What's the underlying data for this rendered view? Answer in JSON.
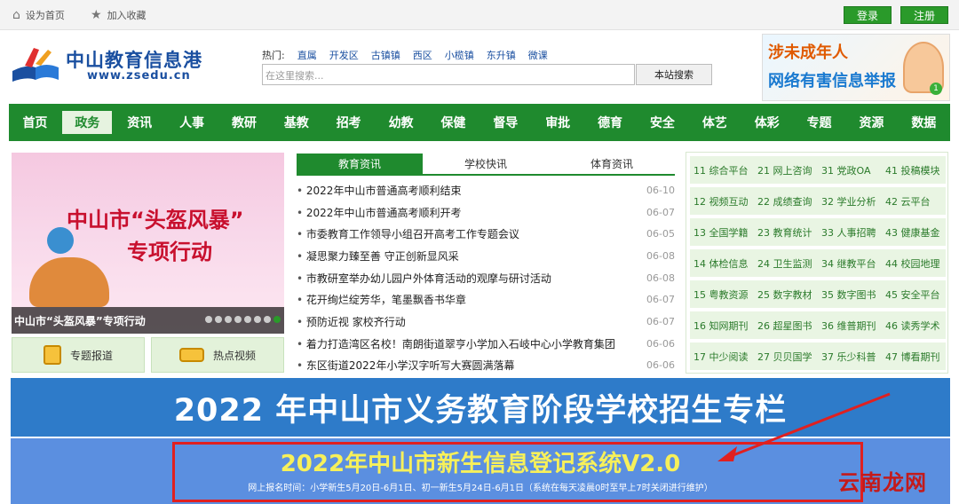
{
  "topbar": {
    "set_home": "设为首页",
    "bookmark": "加入收藏",
    "login": "登录",
    "register": "注册"
  },
  "logo": {
    "name": "中山教育信息港",
    "url": "www.zsedu.cn"
  },
  "hot": {
    "label": "热门:",
    "items": [
      "直属",
      "开发区",
      "古镇镇",
      "西区",
      "小榄镇",
      "东升镇",
      "微课"
    ]
  },
  "search": {
    "placeholder": "在这里搜索...",
    "button": "本站搜索"
  },
  "ad": {
    "line1": "涉未成年人",
    "line2": "网络有害信息举报",
    "num": "1"
  },
  "nav": [
    "首页",
    "政务",
    "资讯",
    "人事",
    "教研",
    "基教",
    "招考",
    "幼教",
    "保健",
    "督导",
    "审批",
    "德育",
    "安全",
    "体艺",
    "体彩",
    "专题",
    "资源",
    "数据"
  ],
  "nav_active": "政务",
  "slide": {
    "title1": "中山市“头盔风暴”",
    "title2": "专项行动",
    "caption": "中山市“头盔风暴”专项行动"
  },
  "quick": {
    "topic": "专题报道",
    "video": "热点视频"
  },
  "tabs": [
    "教育资讯",
    "学校快讯",
    "体育资讯"
  ],
  "news": [
    {
      "t": "2022年中山市普通高考顺利结束",
      "d": "06-10"
    },
    {
      "t": "2022年中山市普通高考顺利开考",
      "d": "06-07"
    },
    {
      "t": "市委教育工作领导小组召开高考工作专题会议",
      "d": "06-05"
    },
    {
      "t": "凝思聚力臻至善 守正创新显风采",
      "d": "06-08"
    },
    {
      "t": "市教研室举办幼儿园户外体育活动的观摩与研讨活动",
      "d": "06-08"
    },
    {
      "t": "花开绚烂绽芳华，笔墨飘香书华章",
      "d": "06-07"
    },
    {
      "t": "预防近视 家校齐行动",
      "d": "06-07"
    },
    {
      "t": "着力打造湾区名校！南朗街道翠亨小学加入石岐中心小学教育集团",
      "d": "06-06"
    },
    {
      "t": "东区街道2022年小学汉字听写大赛圆满落幕",
      "d": "06-06"
    }
  ],
  "links": [
    [
      "11 综合平台",
      "21 网上咨询",
      "31 党政OA",
      "41 投稿模块"
    ],
    [
      "12 视频互动",
      "22 成绩查询",
      "32 学业分析",
      "42 云平台"
    ],
    [
      "13 全国学籍",
      "23 教育统计",
      "33 人事招聘",
      "43 健康基金"
    ],
    [
      "14 体检信息",
      "24 卫生监测",
      "34 继教平台",
      "44 校园地理"
    ],
    [
      "15 粤教资源",
      "25 数字教材",
      "35 数字图书",
      "45 安全平台"
    ],
    [
      "16 知网期刊",
      "26 超星图书",
      "36 维普期刊",
      "46 读秀学术"
    ],
    [
      "17 中少阅读",
      "27 贝贝国学",
      "37 乐少科普",
      "47 博看期刊"
    ]
  ],
  "banner1": "2022 年中山市义务教育阶段学校招生专栏",
  "banner2": {
    "title": "2022年中山市新生信息登记系统V2.0",
    "note": "网上报名时间：小学新生5月20日-6月1日、初一新生5月24日-6月1日（系统在每天凌晨0时至早上7时关闭进行维护）"
  },
  "watermark": "云南龙网",
  "colors": {
    "green": "#1f8a2e",
    "blue": "#2e7bc9",
    "red": "#e02020",
    "yellow": "#f7f05a"
  }
}
